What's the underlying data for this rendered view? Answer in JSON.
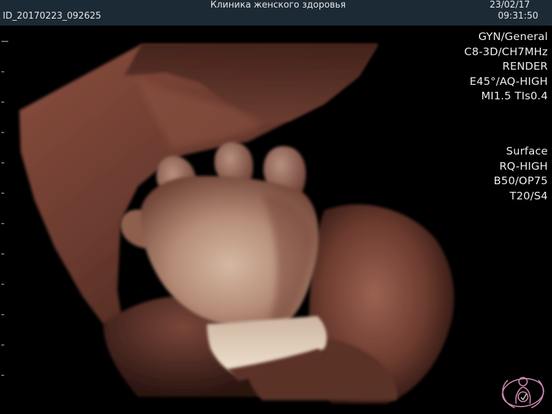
{
  "header": {
    "clinic_name": "Клиника женского здоровья",
    "patient_id": "ID_20170223_092625",
    "date": "23/02/17",
    "time": "09:31:50"
  },
  "scan_params": [
    "GYN/General",
    "C8-3D/CH7MHz",
    "RENDER",
    "E45°/AQ-HIGH",
    "MI1.5  TIs0.4"
  ],
  "render_params": [
    "Surface",
    "RQ-HIGH",
    "B50/OP75",
    "T20/S4"
  ],
  "colors": {
    "header_bg": "#1c2a36",
    "tissue_dark": "#3a1d18",
    "tissue_mid": "#7a4436",
    "tissue_light": "#e7d5bf",
    "logo_pink": "#d08ab4"
  },
  "icons": {
    "logo": "mother-and-baby-logo"
  }
}
